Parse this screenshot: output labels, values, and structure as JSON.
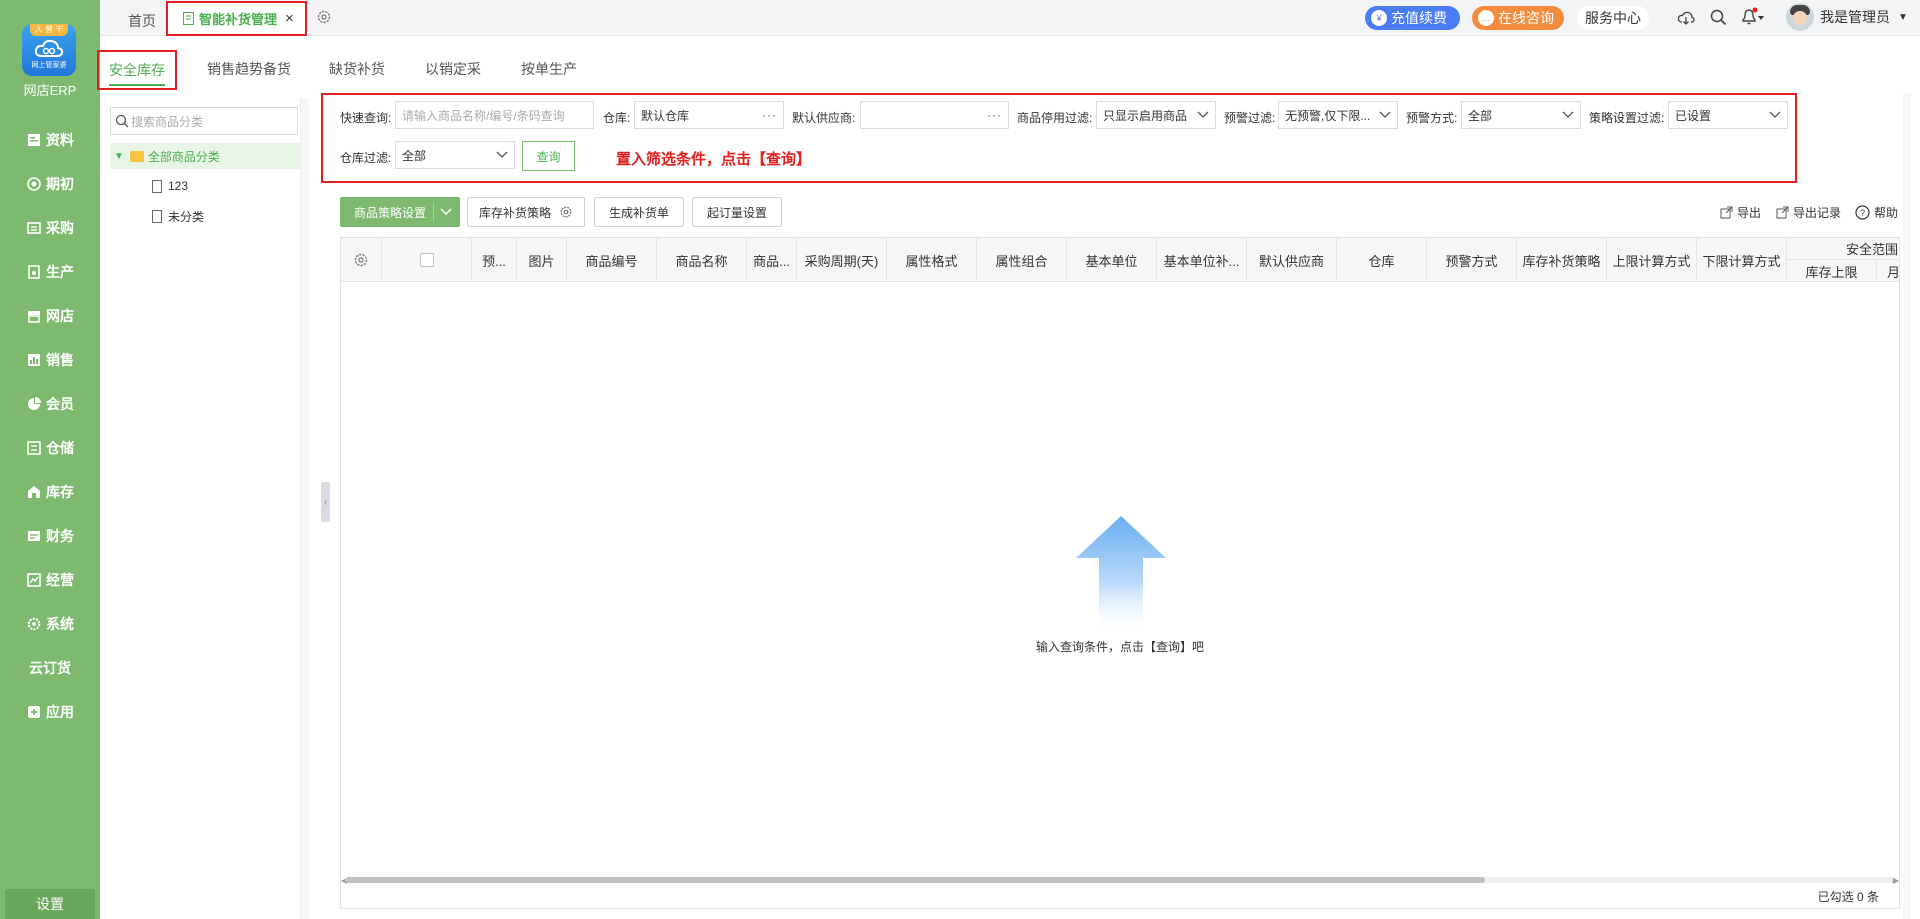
{
  "sidebar": {
    "logo_ribbon": "人 曾 干",
    "logo_sub": "网上管家婆",
    "logo_label": "网店ERP",
    "items": [
      {
        "label": "资料",
        "icon": "profile-icon"
      },
      {
        "label": "期初",
        "icon": "target-icon"
      },
      {
        "label": "采购",
        "icon": "purchase-icon"
      },
      {
        "label": "生产",
        "icon": "production-icon"
      },
      {
        "label": "网店",
        "icon": "store-icon"
      },
      {
        "label": "销售",
        "icon": "sales-chart-icon"
      },
      {
        "label": "会员",
        "icon": "pie-icon"
      },
      {
        "label": "仓储",
        "icon": "warehouse-icon"
      },
      {
        "label": "库存",
        "icon": "house-icon"
      },
      {
        "label": "财务",
        "icon": "finance-icon"
      },
      {
        "label": "经营",
        "icon": "trend-icon"
      },
      {
        "label": "系统",
        "icon": "gear-icon"
      },
      {
        "label": "云订货",
        "icon": ""
      },
      {
        "label": "应用",
        "icon": "plus-icon"
      }
    ],
    "settings": "设置"
  },
  "topbar": {
    "home_tab": "首页",
    "active_tab": "智能补货管理",
    "close_glyph": "×",
    "recharge": "充值续费",
    "consult": "在线咨询",
    "service": "服务中心",
    "user_name": "我是管理员"
  },
  "subtabs": [
    "安全库存",
    "销售趋势备货",
    "缺货补货",
    "以销定采",
    "按单生产"
  ],
  "tree": {
    "search_placeholder": "搜索商品分类",
    "root": "全部商品分类",
    "children": [
      "123",
      "未分类"
    ]
  },
  "filters": {
    "quick_label": "快速查询:",
    "quick_placeholder": "请输入商品名称/编号/条码查询",
    "warehouse_label": "仓库:",
    "warehouse_value": "默认仓库",
    "supplier_label": "默认供应商:",
    "supplier_value": "",
    "disable_label": "商品停用过滤:",
    "disable_value": "只显示启用商品",
    "warn_filter_label": "预警过滤:",
    "warn_filter_value": "无预警,仅下限...",
    "warn_mode_label": "预警方式:",
    "warn_mode_value": "全部",
    "strategy_label": "策略设置过滤:",
    "strategy_value": "已设置",
    "wh_filter_label": "仓库过滤:",
    "wh_filter_value": "全部",
    "query_btn": "查询",
    "hint": "置入筛选条件，点击【查询】"
  },
  "toolbar": {
    "strategy_btn": "商品策略设置",
    "replenish_btn": "库存补货策略",
    "generate_btn": "生成补货单",
    "moq_btn": "起订量设置",
    "export": "导出",
    "export_log": "导出记录",
    "help": "帮助"
  },
  "table": {
    "columns": [
      "",
      "",
      "预...",
      "图片",
      "商品编号",
      "商品名称",
      "商品...",
      "采购周期(天)",
      "属性格式",
      "属性组合",
      "基本单位",
      "基本单位补...",
      "默认供应商",
      "仓库",
      "预警方式",
      "库存补货策略",
      "上限计算方式",
      "下限计算方式"
    ],
    "group_header": "安全范围",
    "sub_columns": [
      "库存上限",
      "月"
    ],
    "empty_text": "输入查询条件，点击【查询】吧",
    "selected_count": "已勾选 0 条"
  }
}
